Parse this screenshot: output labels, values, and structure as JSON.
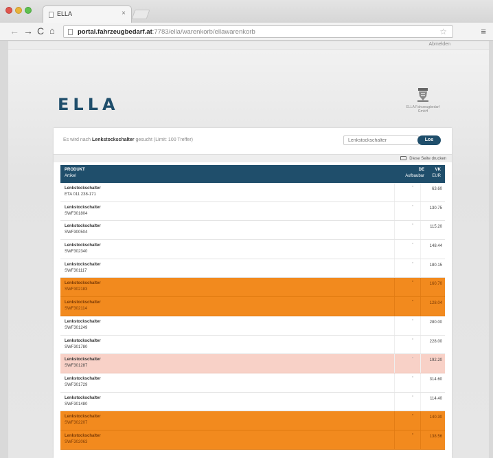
{
  "browser": {
    "tab_title": "ELLA",
    "tab_close": "×",
    "url_host": "portal.fahrzeugbedarf.at",
    "url_rest": ":7783/ella/warenkorb/ellawarenkorb",
    "star": "☆",
    "menu": "≡",
    "back": "←",
    "forward": "→",
    "reload": "C",
    "home": "⌂"
  },
  "page": {
    "util_link": "Abmelden",
    "logo": "ELLA",
    "crest_caption": "ELLA Fahrzeugbedarf GmbH",
    "search": {
      "result_prefix": "Es wird nach",
      "result_term": "Lenkstockschalter",
      "result_suffix": "gesucht (Limit: 100 Treffer)",
      "placeholder": "Lenkstockschalter",
      "button": "Los"
    },
    "print_label": "Diese Seite drucken",
    "table": {
      "col_product": "PRODUKT",
      "col_artikel": "Artikel",
      "col_de": "DE",
      "col_verf": "Aufbaubar",
      "col_vk": "VK",
      "col_eur": "EUR"
    },
    "rows": [
      {
        "name": "Lenkstockschalter",
        "artnr": "ETA 011 238-171",
        "stock": "*",
        "price": "63.60",
        "style": "plain"
      },
      {
        "name": "Lenkstockschalter",
        "artnr": "SWF301804",
        "stock": "*",
        "price": "130.75",
        "style": "plain"
      },
      {
        "name": "Lenkstockschalter",
        "artnr": "SWF300504",
        "stock": "*",
        "price": "115.20",
        "style": "plain"
      },
      {
        "name": "Lenkstockschalter",
        "artnr": "SWF302340",
        "stock": "*",
        "price": "148.44",
        "style": "plain"
      },
      {
        "name": "Lenkstockschalter",
        "artnr": "SWF301117",
        "stock": "*",
        "price": "180.15",
        "style": "plain"
      },
      {
        "name": "Lenkstockschalter",
        "artnr": "SWF302183",
        "stock": "*",
        "price": "160.70",
        "style": "orange"
      },
      {
        "name": "Lenkstockschalter",
        "artnr": "SWF302114",
        "stock": "*",
        "price": "128.04",
        "style": "orange"
      },
      {
        "name": "Lenkstockschalter",
        "artnr": "SWF301249",
        "stock": "*",
        "price": "280.00",
        "style": "plain"
      },
      {
        "name": "Lenkstockschalter",
        "artnr": "SWF301780",
        "stock": "*",
        "price": "228.00",
        "style": "plain"
      },
      {
        "name": "Lenkstockschalter",
        "artnr": "SWF301287",
        "stock": "*",
        "price": "192.20",
        "style": "pink"
      },
      {
        "name": "Lenkstockschalter",
        "artnr": "SWF301729",
        "stock": "*",
        "price": "314.60",
        "style": "plain"
      },
      {
        "name": "Lenkstockschalter",
        "artnr": "SWF301480",
        "stock": "*",
        "price": "114.40",
        "style": "plain"
      },
      {
        "name": "Lenkstockschalter",
        "artnr": "SWF302207",
        "stock": "*",
        "price": "140.30",
        "style": "orange"
      },
      {
        "name": "Lenkstockschalter",
        "artnr": "SWF302063",
        "stock": "*",
        "price": "138.56",
        "style": "orange"
      }
    ]
  },
  "colors": {
    "brand": "#1f4e6b",
    "highlight_orange": "#f28a1e",
    "highlight_pink": "#f8d1c7"
  }
}
